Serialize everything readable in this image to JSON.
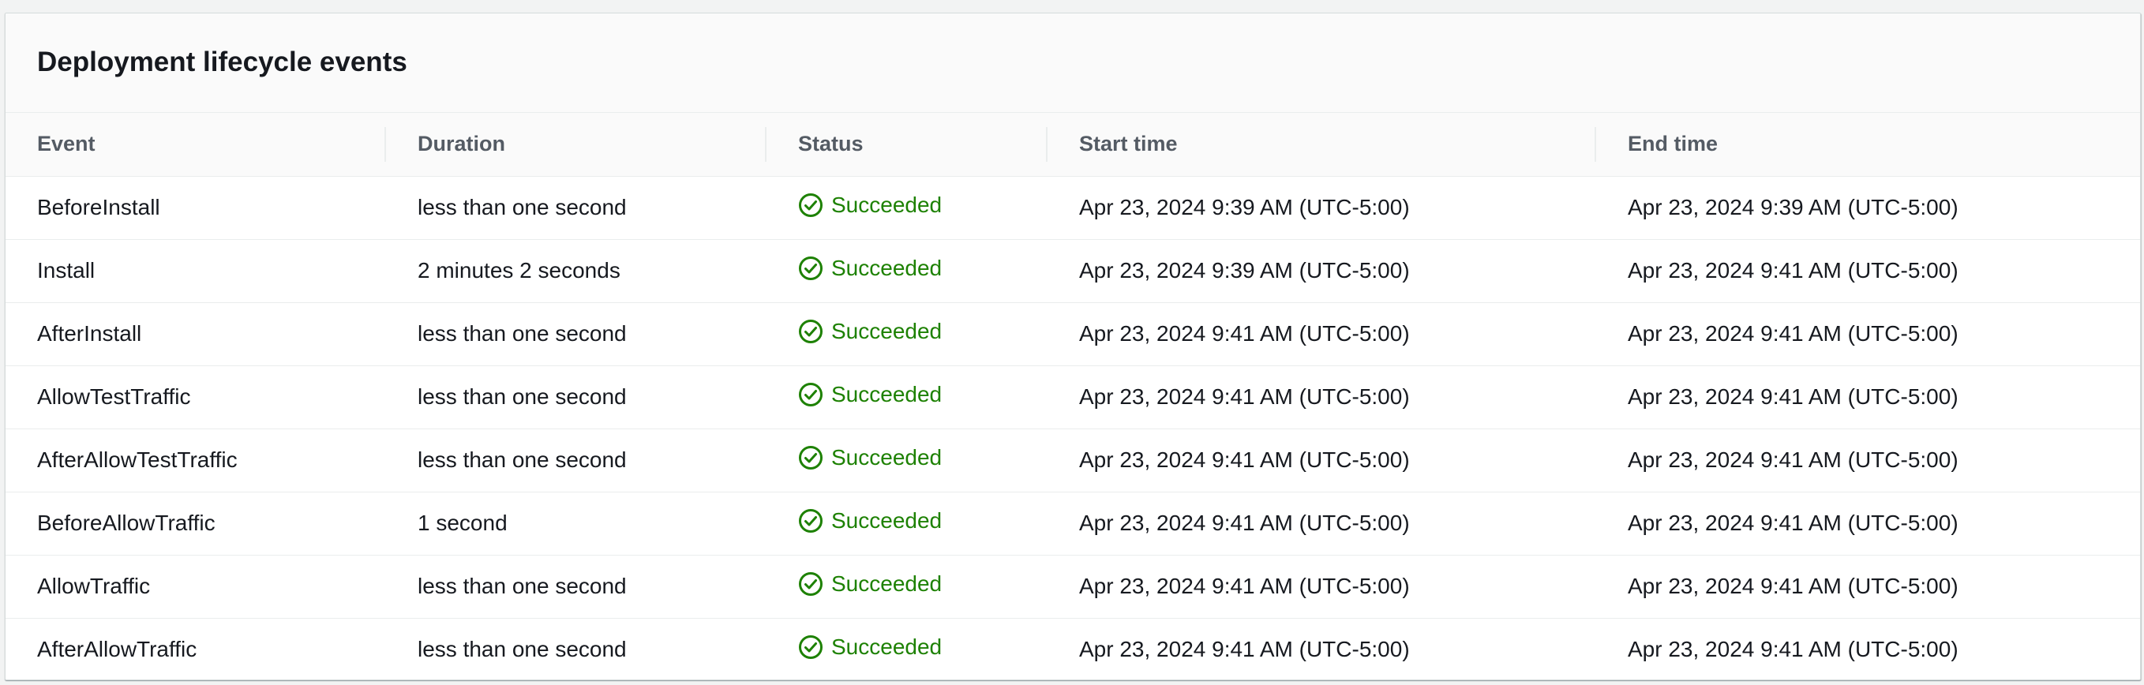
{
  "panel": {
    "title": "Deployment lifecycle events"
  },
  "table": {
    "columns": [
      "Event",
      "Duration",
      "Status",
      "Start time",
      "End time"
    ],
    "rows": [
      {
        "event": "BeforeInstall",
        "duration": "less than one second",
        "status": "Succeeded",
        "start": "Apr 23, 2024 9:39 AM (UTC-5:00)",
        "end": "Apr 23, 2024 9:39 AM (UTC-5:00)"
      },
      {
        "event": "Install",
        "duration": "2 minutes 2 seconds",
        "status": "Succeeded",
        "start": "Apr 23, 2024 9:39 AM (UTC-5:00)",
        "end": "Apr 23, 2024 9:41 AM (UTC-5:00)"
      },
      {
        "event": "AfterInstall",
        "duration": "less than one second",
        "status": "Succeeded",
        "start": "Apr 23, 2024 9:41 AM (UTC-5:00)",
        "end": "Apr 23, 2024 9:41 AM (UTC-5:00)"
      },
      {
        "event": "AllowTestTraffic",
        "duration": "less than one second",
        "status": "Succeeded",
        "start": "Apr 23, 2024 9:41 AM (UTC-5:00)",
        "end": "Apr 23, 2024 9:41 AM (UTC-5:00)"
      },
      {
        "event": "AfterAllowTestTraffic",
        "duration": "less than one second",
        "status": "Succeeded",
        "start": "Apr 23, 2024 9:41 AM (UTC-5:00)",
        "end": "Apr 23, 2024 9:41 AM (UTC-5:00)"
      },
      {
        "event": "BeforeAllowTraffic",
        "duration": "1 second",
        "status": "Succeeded",
        "start": "Apr 23, 2024 9:41 AM (UTC-5:00)",
        "end": "Apr 23, 2024 9:41 AM (UTC-5:00)"
      },
      {
        "event": "AllowTraffic",
        "duration": "less than one second",
        "status": "Succeeded",
        "start": "Apr 23, 2024 9:41 AM (UTC-5:00)",
        "end": "Apr 23, 2024 9:41 AM (UTC-5:00)"
      },
      {
        "event": "AfterAllowTraffic",
        "duration": "less than one second",
        "status": "Succeeded",
        "start": "Apr 23, 2024 9:41 AM (UTC-5:00)",
        "end": "Apr 23, 2024 9:41 AM (UTC-5:00)"
      }
    ]
  },
  "theme": {
    "success_color": "#1d8102",
    "status_icon": "check-circle-icon"
  }
}
